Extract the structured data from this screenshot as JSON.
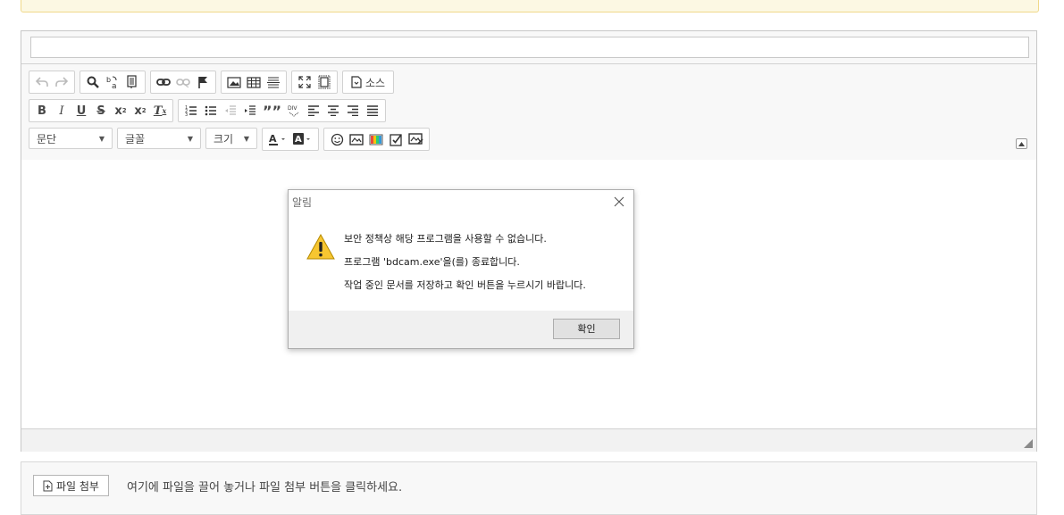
{
  "editor": {
    "title_value": "",
    "toolbar": {
      "source_label": "소스",
      "format_combo": "문단",
      "font_combo": "글꼴",
      "size_combo": "크기"
    }
  },
  "dialog": {
    "title": "알림",
    "messages": [
      "보안 정책상 해당 프로그램을 사용할 수 없습니다.",
      "프로그램 'bdcam.exe'을(를) 종료합니다.",
      "작업 중인 문서를 저장하고 확인 버튼을 누르시기 바랍니다."
    ],
    "ok_label": "확인"
  },
  "attachment": {
    "button_label": "파일 첨부",
    "hint": "여기에 파일을 끌어 놓거나 파일 첨부 버튼을 클릭하세요."
  },
  "colors": {
    "notice_bg": "#fcf8e3",
    "warning_yellow": "#f7c631",
    "border": "#c8c8c8"
  }
}
